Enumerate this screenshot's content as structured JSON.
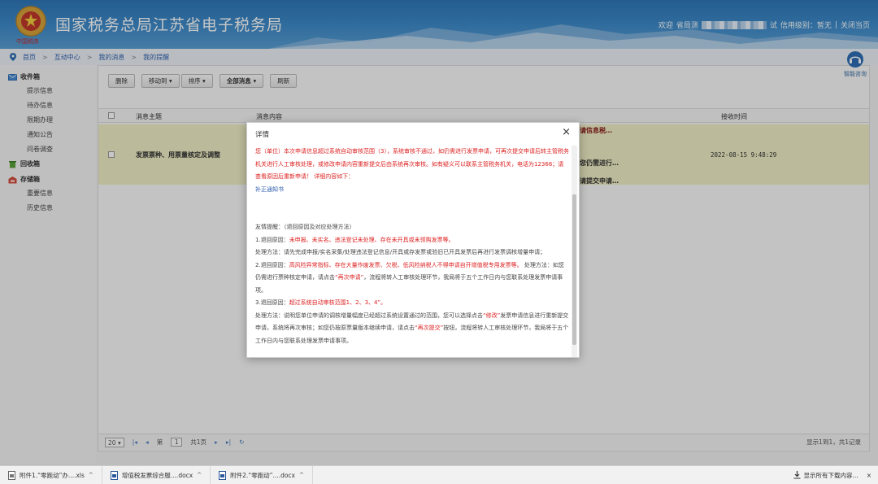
{
  "header": {
    "emblem_text": "中国税务",
    "site_title": "国家税务总局江苏省电子税务局",
    "welcome": "欢迎",
    "user_prefix": "省局测",
    "user_suffix": "试",
    "credit": "信用级别：暂无",
    "divider": "|",
    "close": "关闭当页"
  },
  "breadcrumb": {
    "items": [
      "首页",
      "互动中心",
      "我的消息",
      "我的提醒"
    ],
    "separator": ">"
  },
  "helper": {
    "label": "智能咨询"
  },
  "sidebar": {
    "inbox": "收件箱",
    "inbox_items": [
      "提示信息",
      "待办信息",
      "限期办理",
      "通知公告",
      "问卷调查"
    ],
    "recycle": "回收箱",
    "storage": "存储箱",
    "storage_items": [
      "重要信息",
      "历史信息"
    ]
  },
  "toolbar": {
    "delete": "删除",
    "move_to": "移动到",
    "sort": "排序",
    "filter": "全部消息",
    "refresh": "刷新",
    "caret": "▾"
  },
  "table": {
    "headers": [
      "消息主题",
      "消息内容",
      "接收时间"
    ],
    "row": {
      "subject": "发票票种、用票量核定及调整",
      "peek1": "请信息税…",
      "peek2": "您仍需进行…",
      "peek3": "请提交申请…",
      "time": "2022-08-15 9:48:29"
    }
  },
  "pager": {
    "page_size": "20",
    "page_prefix": "第",
    "page_value": "1",
    "page_suffix": "共1页",
    "summary": "显示1到1，共1记录",
    "first": "|◂",
    "prev": "◂",
    "next": "▸",
    "last": "▸|",
    "refresh": "↻"
  },
  "dialog": {
    "title": "详情",
    "close": "×",
    "para1": "您（单位）本次申请信息超过系统自动审核范围（3），系统审核不通过，如仍需进行发票申请，可再次提交申请后转主管税务机关进行人工审核处理，或修改申请内容重新提交后由系统再次审核。如有疑义可以联系主管税务机关，电话为12366；请查看原因后重新申请！ 详细内容如下：",
    "link": "补正通知书",
    "tip_title": "友情提醒：（退回原因及对应处理方法）",
    "r1_label": "1.退回原因：",
    "r1_reason": "未申报、未实名、违法登记未处理、存在未开具或未领购发票等。",
    "r1_fix": "处理方法：请先完成申报/实名采集/处理违法登记信息/开具或存发票或验旧已开具发票后再进行发票调核增量申请；",
    "r2_label": "2.退回原因：",
    "r2_reason": "高风险异常指标、存在大量作废发票、欠税、低风险纳税人不得申请自开增值税专用发票等。",
    "r2_fix_a": "处理方法：如您仍需进行票种核定申请，请点击",
    "r2_fix_btn": "“再次申请”",
    "r2_fix_b": "，流程将转人工审核处理环节，我局将于五个工作日内与您联系处理发票申请事项。",
    "r3_label": "3.退回原因：",
    "r3_reason": "超过系统自动审核范围1、2、3、4”。",
    "r3_fix_a": "处理方法：说明您单位申请的调核增量幅度已经超过系统设置通过的范围，您可以选择点击",
    "r3_fix_btn1": "“修改”",
    "r3_fix_b": "发票申请信息进行重新提交申请，系统将再次审核；如您仍按原票量版本继续申请，请点击",
    "r3_fix_btn2": "“再次提交”",
    "r3_fix_c": "按钮，流程将转人工审核处理环节，我局将于五个工作日内与您联系处理发票申请事项。"
  },
  "downloads": {
    "items": [
      "附件1.“零跑动”办....xls",
      "增值税发票综合服....docx",
      "附件2.“零跑动”....docx"
    ],
    "chevron": "^",
    "show_all": "显示所有下载内容...",
    "close": "×"
  },
  "colors": {
    "header_blue": "#2f77b8",
    "highlight_row": "#f0efc6",
    "warning_red": "#dd2222",
    "link_blue": "#2f5fae"
  }
}
